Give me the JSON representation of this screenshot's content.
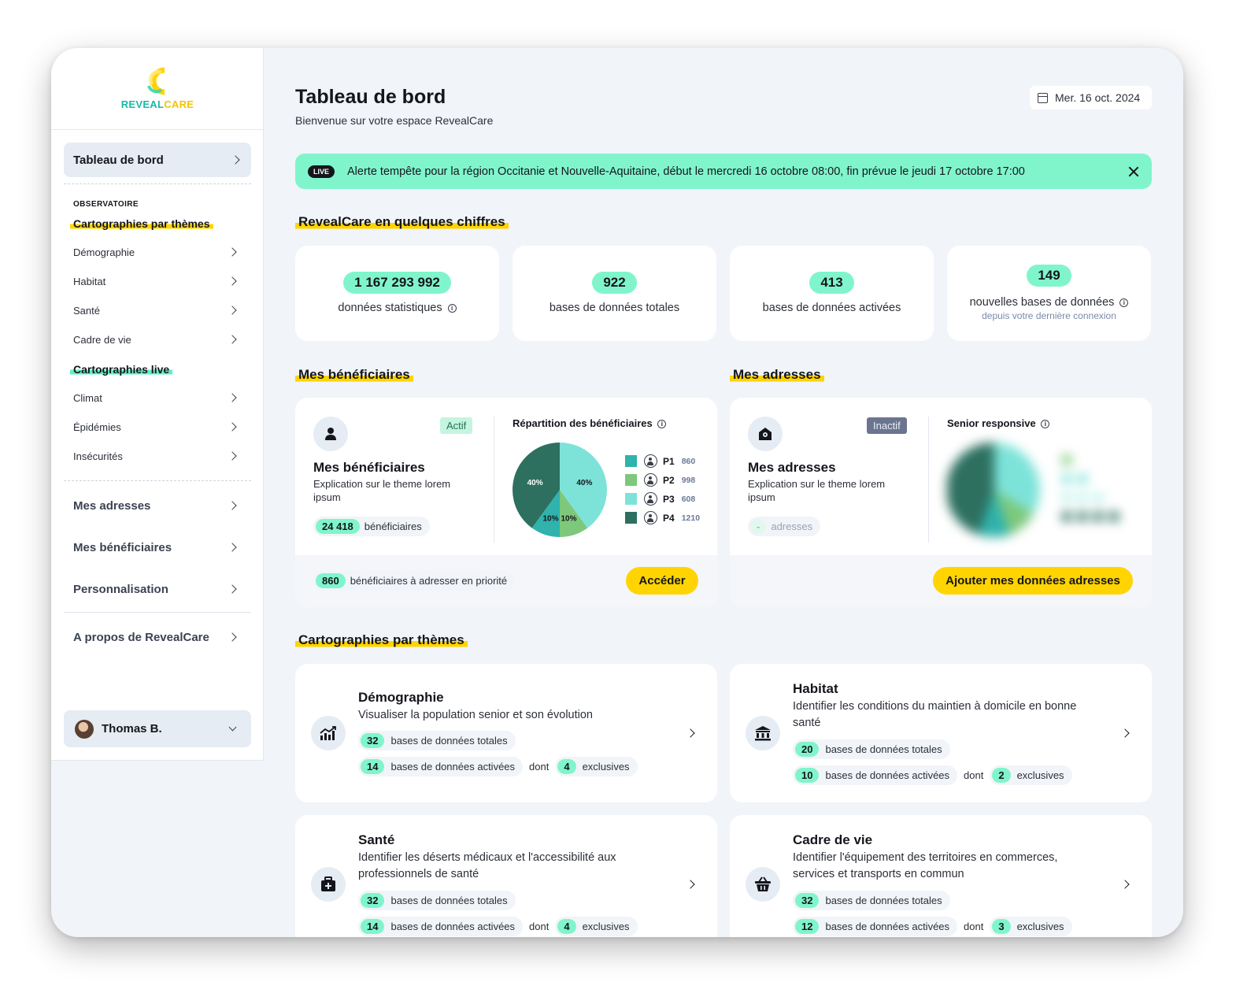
{
  "brand": {
    "name_part1": "REVEAL",
    "name_part2": "CARE"
  },
  "sidebar": {
    "active_item": "Tableau de bord",
    "section_caption": "OBSERVATOIRE",
    "group1_title": "Cartographies par thèmes",
    "group1_items": [
      "Démographie",
      "Habitat",
      "Santé",
      "Cadre de vie"
    ],
    "group2_title": "Cartographies live",
    "group2_items": [
      "Climat",
      "Épidémies",
      "Insécurités"
    ],
    "main_items": [
      "Mes adresses",
      "Mes bénéficiaires",
      "Personnalisation"
    ],
    "about_item": "A propos de RevealCare",
    "user_name": "Thomas B."
  },
  "header": {
    "title": "Tableau de bord",
    "subtitle": "Bienvenue sur votre espace RevealCare",
    "date": "Mer. 16 oct. 2024"
  },
  "alert": {
    "badge": "LIVE",
    "text": "Alerte tempête pour la région Occitanie et Nouvelle-Aquitaine, début le mercredi 16 octobre 08:00, fin prévue le jeudi 17 octobre 17:00"
  },
  "stats_section": {
    "title": "RevealCare en quelques chiffres",
    "cards": [
      {
        "value": "1 167 293 992",
        "label": "données statistiques",
        "sub": ""
      },
      {
        "value": "922",
        "label": "bases de données totales",
        "sub": ""
      },
      {
        "value": "413",
        "label": "bases de données activées",
        "sub": ""
      },
      {
        "value": "149",
        "label": "nouvelles bases de données",
        "sub": "depuis votre dernière connexion"
      }
    ]
  },
  "beneficiaires": {
    "section_title": "Mes bénéficiaires",
    "status": "Actif",
    "card_title": "Mes bénéficiaires",
    "description": "Explication sur le theme lorem ipsum",
    "count": "24 418",
    "count_label": "bénéficiaires",
    "chart_title": "Répartition des bénéficiaires",
    "priority_count": "860",
    "priority_label": "bénéficiaires à adresser en priorité",
    "button": "Accéder"
  },
  "adresses": {
    "section_title": "Mes adresses",
    "status": "Inactif",
    "card_title": "Mes adresses",
    "description": "Explication sur le theme lorem ipsum",
    "count": "-",
    "count_label": "adresses",
    "chart_title": "Senior responsive",
    "button": "Ajouter mes données adresses"
  },
  "chart_data": {
    "type": "pie",
    "title": "Répartition des bénéficiaires",
    "slices": [
      {
        "label": "40%",
        "value": 40,
        "color": "#7de3d9"
      },
      {
        "label": "10%",
        "value": 10,
        "color": "#7dc87b"
      },
      {
        "label": "10%",
        "value": 10,
        "color": "#2fb3ac"
      },
      {
        "label": "40%",
        "value": 40,
        "color": "#2d7060"
      }
    ],
    "legend": [
      {
        "name": "P1",
        "value": "860",
        "color": "#2fb3ac"
      },
      {
        "name": "P2",
        "value": "998",
        "color": "#7dc87b"
      },
      {
        "name": "P3",
        "value": "608",
        "color": "#7de3d9"
      },
      {
        "name": "P4",
        "value": "1210",
        "color": "#2d7060"
      }
    ]
  },
  "themes": {
    "section_title": "Cartographies par thèmes",
    "cards": [
      {
        "title": "Démographie",
        "description": "Visualiser la population senior et son évolution",
        "total": "32",
        "total_label": "bases de données totales",
        "active": "14",
        "active_label": "bases de données activées",
        "dont": "dont",
        "exclusive": "4",
        "exclusive_label": "exclusives",
        "icon": "chart-growth-icon"
      },
      {
        "title": "Habitat",
        "description": "Identifier les conditions du maintien à domicile en bonne santé",
        "total": "20",
        "total_label": "bases de données totales",
        "active": "10",
        "active_label": "bases de données activées",
        "dont": "dont",
        "exclusive": "2",
        "exclusive_label": "exclusives",
        "icon": "bank-icon"
      },
      {
        "title": "Santé",
        "description": "Identifier les déserts médicaux et l'accessibilité aux professionnels de santé",
        "total": "32",
        "total_label": "bases de données totales",
        "active": "14",
        "active_label": "bases de données activées",
        "dont": "dont",
        "exclusive": "4",
        "exclusive_label": "exclusives",
        "icon": "medical-bag-icon"
      },
      {
        "title": "Cadre de vie",
        "description": "Identifier l'équipement des territoires en commerces, services et transports en commun",
        "total": "32",
        "total_label": "bases de données totales",
        "active": "12",
        "active_label": "bases de données activées",
        "dont": "dont",
        "exclusive": "3",
        "exclusive_label": "exclusives",
        "icon": "basket-icon"
      }
    ]
  }
}
